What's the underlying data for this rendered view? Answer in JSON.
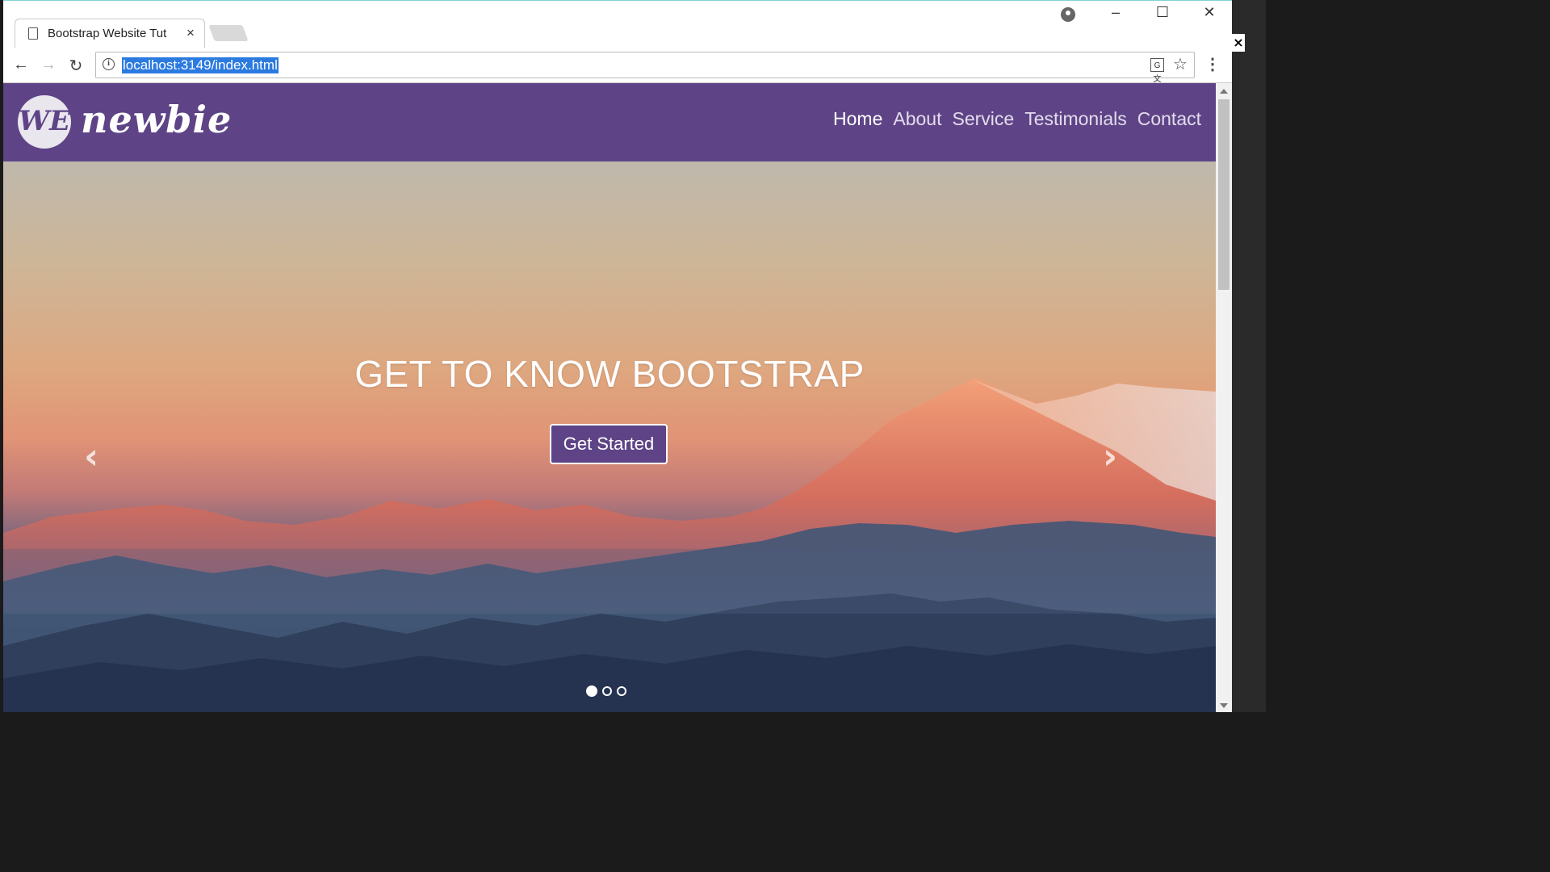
{
  "browser": {
    "tab_title": "Bootstrap Website Tut",
    "tab_close": "×",
    "url": "localhost:3149/index.html",
    "window_controls": {
      "minimize": "–",
      "maximize": "☐",
      "close": "✕"
    }
  },
  "site": {
    "logo_mark": "WE",
    "logo_text": "newbie",
    "nav": [
      {
        "label": "Home",
        "active": true
      },
      {
        "label": "About"
      },
      {
        "label": "Service"
      },
      {
        "label": "Testimonials"
      },
      {
        "label": "Contact"
      }
    ],
    "hero": {
      "title": "GET TO KNOW BOOTSTRAP",
      "cta": "Get Started",
      "slides": 3,
      "active_slide": 1
    },
    "colors": {
      "brand": "#5e4486"
    }
  }
}
